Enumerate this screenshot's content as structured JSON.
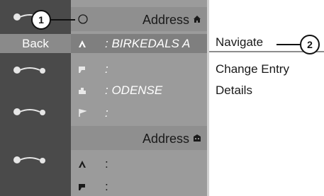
{
  "back_label": "Back",
  "section_header": "Address",
  "entries": [
    {
      "icon": "letter-a-icon",
      "value": ": BIRKEDALS A"
    },
    {
      "icon": "street-icon",
      "value": ":"
    },
    {
      "icon": "city-icon",
      "value": ": ODENSE"
    },
    {
      "icon": "flag-icon",
      "value": ":"
    }
  ],
  "second_header": "Address",
  "second_entries": [
    {
      "icon": "letter-a-icon",
      "value": ":"
    },
    {
      "icon": "street-icon",
      "value": ":"
    }
  ],
  "menu": [
    "Navigate",
    "Change Entry",
    "Details"
  ],
  "callouts": [
    "1",
    "2"
  ],
  "colors": {
    "strip": "#4a4a4a",
    "panel": "#9b9b9b",
    "header": "#8f8f8f",
    "selected_row": "#7f7f7f"
  }
}
